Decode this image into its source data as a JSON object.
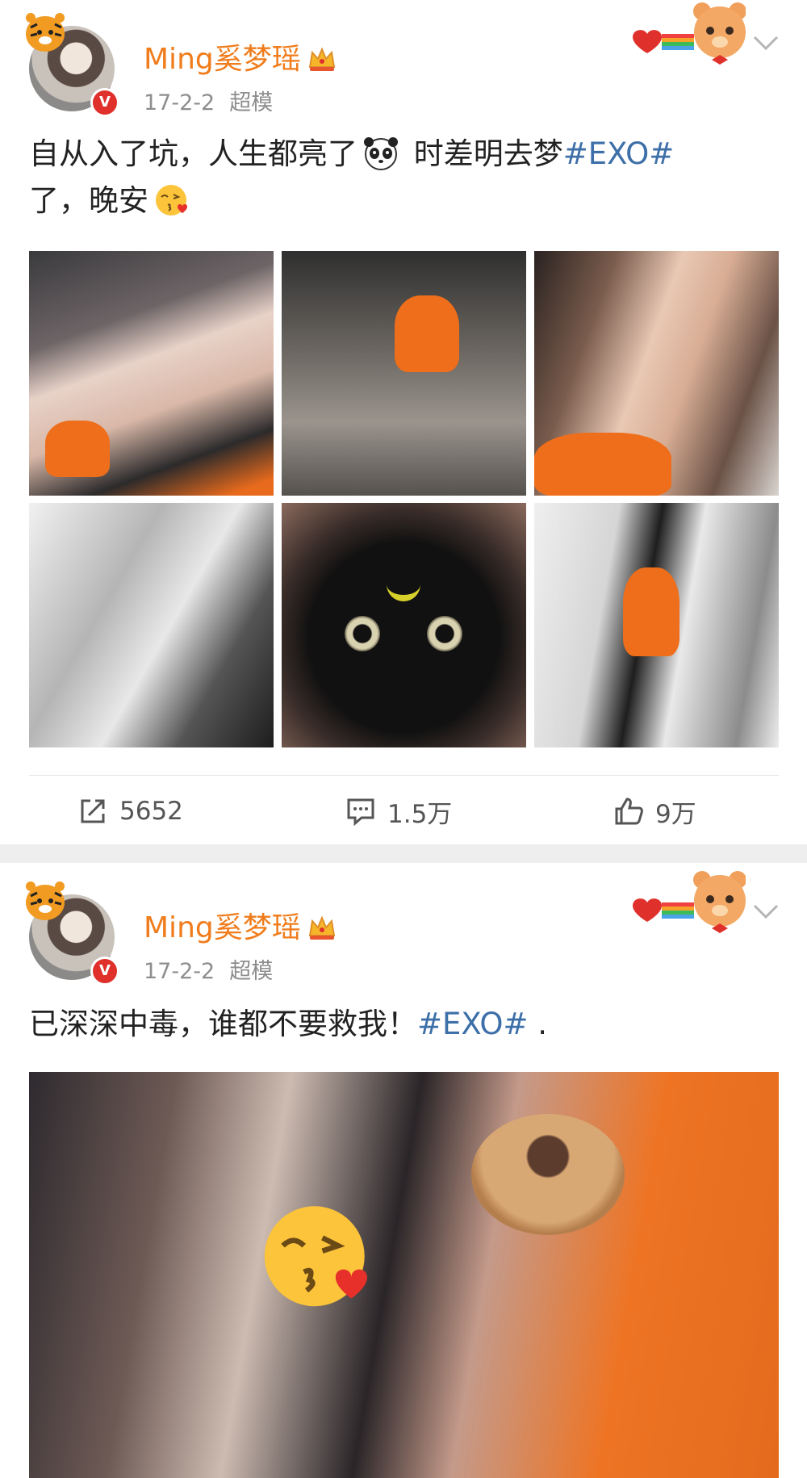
{
  "posts": [
    {
      "author": "Ming奚梦瑶",
      "time": "17-2-2",
      "source": "超模",
      "text_parts": [
        "自从入了坑，人生都亮了",
        " 时差明去梦",
        "#EXO#",
        "了，晚安"
      ],
      "image_count": 6,
      "actions": {
        "repost_count": "5652",
        "comment_count": "1.5万",
        "like_count": "9万"
      }
    },
    {
      "author": "Ming奚梦瑶",
      "time": "17-2-2",
      "source": "超模",
      "text_parts": [
        "已深深中毒，谁都不要救我！",
        "#EXO#",
        " ."
      ]
    }
  ],
  "colors": {
    "author_name": "#f07c1b",
    "hashtag": "#3d6fa8",
    "verified_badge": "#e0302b",
    "meta_text": "#8e8e8e"
  },
  "icons": [
    "tiger-sticker-icon",
    "verified-icon",
    "crown-icon",
    "bear-decoration-icon",
    "chevron-down-icon",
    "panda-emoji-icon",
    "kiss-emoji-icon",
    "repost-icon",
    "comment-icon",
    "like-icon"
  ]
}
